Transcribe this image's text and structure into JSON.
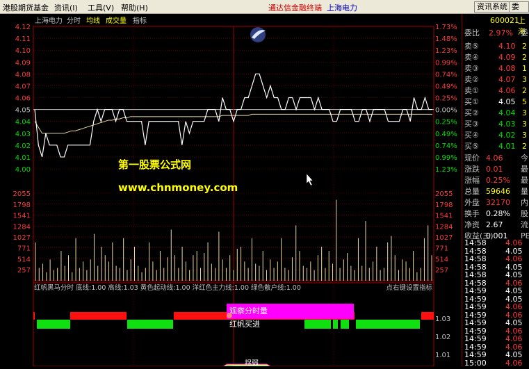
{
  "menu": {
    "title": "港股期货基金",
    "info": "资讯(I)",
    "tools": "工具(V)",
    "help": "帮助(H)",
    "brand": "通达信金融终端",
    "stock": "上海电力",
    "btn_info": "资讯系统",
    "btn_other": "委托买"
  },
  "header": {
    "name": "上海电力",
    "tabs": [
      "分时",
      "均线",
      "成交量",
      "指标"
    ]
  },
  "price_axis": {
    "left": [
      "4.12",
      "4.11",
      "4.10",
      "4.09",
      "4.08",
      "4.07",
      "4.06",
      "4.05",
      "4.04",
      "4.03",
      "4.02",
      "4.01",
      "4.00"
    ],
    "right": [
      "1.73%",
      "1.48%",
      "1.23%",
      "0.99%",
      "0.74%",
      "0.49%",
      "0.25%",
      "0.00%",
      "0.25%",
      "0.49%",
      "0.74%",
      "0.99%",
      "1.23%"
    ]
  },
  "volume_axis": [
    "2055",
    "1798",
    "1541",
    "1284",
    "1027",
    "771",
    "514",
    "257"
  ],
  "watermark": {
    "cn": "第一股票公式网",
    "url": "www.chnmoney.com"
  },
  "indicator": {
    "title_line": "红帆黑马分时  底线:1.00  高线:1.03  黄色起动线:1.00  洋红色主力线:1.00  绿色散户线:1.00",
    "right_hint": "点右键设置指标",
    "label_watch": "观察分时量",
    "label_buy": "红帆买进",
    "label_spike": "拐弱",
    "axis": [
      "1.03",
      "1.02",
      "1.01"
    ]
  },
  "time_labels": [
    "09:30",
    "11:30",
    "13:00",
    "15:00"
  ],
  "chart_data": {
    "type": "line",
    "prev_close": 4.05,
    "ylim": [
      4.0,
      4.12
    ],
    "series": [
      {
        "name": "price",
        "values": [
          4.05,
          4.02,
          4.01,
          4.03,
          4.02,
          4.02,
          4.02,
          4.01,
          4.01,
          4.02,
          4.02,
          4.02,
          4.02,
          4.02,
          4.02,
          4.02,
          4.04,
          4.05,
          4.04,
          4.05,
          4.05,
          4.05,
          4.04,
          4.05,
          4.05,
          4.04,
          4.04,
          4.04,
          4.04,
          4.04,
          4.02,
          4.04,
          4.04,
          4.04,
          4.04,
          4.04,
          4.04,
          4.04,
          4.04,
          4.04,
          4.02,
          4.04,
          4.03,
          4.04,
          4.04,
          4.04,
          4.04,
          4.05,
          4.05,
          4.05,
          4.04,
          4.06,
          4.05,
          4.05,
          4.04,
          4.05,
          4.05,
          4.06,
          4.06,
          4.07,
          4.08,
          4.08,
          4.07,
          4.06,
          4.07,
          4.06,
          4.06,
          4.05,
          4.05,
          4.06,
          4.06,
          4.05,
          4.06,
          4.06,
          4.06,
          4.06,
          4.05,
          4.06,
          4.05,
          4.05,
          4.05,
          4.04,
          4.04,
          4.05,
          4.05,
          4.05,
          4.05,
          4.04,
          4.04,
          4.05,
          4.05,
          4.04,
          4.05,
          4.05,
          4.05,
          4.05,
          4.04,
          4.04,
          4.04,
          4.04,
          4.05,
          4.05,
          4.04,
          4.06,
          4.05,
          4.05,
          4.06,
          4.05,
          4.05
        ]
      },
      {
        "name": "avg",
        "values": [
          4.04,
          4.035,
          4.03,
          4.03,
          4.03,
          4.03,
          4.03,
          4.03,
          4.03,
          4.031,
          4.032,
          4.032,
          4.033,
          4.034,
          4.035,
          4.036,
          4.037,
          4.038,
          4.039,
          4.04,
          4.041,
          4.041,
          4.042,
          4.042,
          4.043,
          4.043,
          4.044,
          4.044,
          4.044,
          4.044,
          4.044,
          4.044,
          4.044,
          4.044,
          4.044,
          4.044,
          4.044,
          4.044,
          4.044,
          4.044,
          4.044,
          4.044,
          4.044,
          4.044,
          4.044,
          4.044,
          4.044,
          4.044,
          4.044,
          4.044,
          4.044,
          4.045,
          4.045,
          4.045,
          4.045,
          4.045,
          4.045,
          4.045,
          4.045,
          4.046,
          4.046,
          4.046,
          4.046,
          4.046,
          4.046,
          4.046,
          4.046,
          4.046,
          4.046,
          4.046,
          4.046,
          4.046,
          4.046,
          4.046,
          4.046,
          4.046,
          4.046,
          4.046,
          4.046,
          4.046,
          4.046,
          4.046,
          4.046,
          4.046,
          4.046,
          4.046,
          4.046,
          4.046,
          4.046,
          4.046,
          4.046,
          4.046,
          4.046,
          4.046,
          4.046,
          4.046,
          4.046,
          4.046,
          4.046,
          4.046,
          4.046,
          4.046,
          4.046,
          4.046,
          4.046,
          4.046,
          4.046,
          4.046,
          4.046
        ]
      }
    ],
    "volume": [
      900,
      300,
      400,
      200,
      500,
      250,
      300,
      700,
      350,
      600,
      200,
      1000,
      300,
      450,
      250,
      500,
      1100,
      350,
      800,
      600,
      450,
      900,
      350,
      300,
      1000,
      250,
      500,
      800,
      350,
      200,
      300,
      900,
      450,
      250,
      700,
      300,
      550,
      1200,
      600,
      300,
      800,
      450,
      250,
      600,
      700,
      300,
      650,
      900,
      400,
      300,
      1150,
      500,
      300,
      600,
      250,
      750,
      800,
      450,
      300,
      1000,
      400,
      350,
      700,
      250,
      500,
      300,
      450,
      1000,
      300,
      250,
      550,
      1300,
      700,
      350,
      300,
      450,
      250,
      600,
      800,
      300,
      700,
      400,
      1900,
      300,
      500,
      650,
      350,
      250,
      1000,
      350,
      1400,
      300,
      450,
      800,
      250,
      300,
      900,
      1050,
      600,
      250,
      500,
      450,
      300,
      700,
      200,
      300,
      1000,
      1300,
      600
    ],
    "volume_ylim": [
      0,
      2055
    ]
  },
  "quote": {
    "code": "600021",
    "name": "上海",
    "ratio_label": "委比",
    "ratio_value": "2.97%",
    "ratio_tail": "委",
    "sells": [
      {
        "label": "卖⑤",
        "price": "4.10",
        "vol": "2"
      },
      {
        "label": "卖④",
        "price": "4.09",
        "vol": "2"
      },
      {
        "label": "卖③",
        "price": "4.08",
        "vol": "1"
      },
      {
        "label": "卖②",
        "price": "4.07",
        "vol": "3"
      },
      {
        "label": "卖①",
        "price": "4.06",
        "vol": "2"
      }
    ],
    "buys": [
      {
        "label": "买①",
        "price": "4.05",
        "vol": "5"
      },
      {
        "label": "买②",
        "price": "4.04",
        "vol": "3"
      },
      {
        "label": "买③",
        "price": "4.03",
        "vol": "3"
      },
      {
        "label": "买④",
        "price": "4.02",
        "vol": "3"
      },
      {
        "label": "买⑤",
        "price": "4.01",
        "vol": "2"
      }
    ],
    "stats": [
      {
        "label": "现价",
        "value": "4.06",
        "tail": "今",
        "color": "red"
      },
      {
        "label": "涨跌",
        "value": "0.01",
        "tail": "最",
        "color": "red"
      },
      {
        "label": "涨幅",
        "value": "0.25%",
        "tail": "最",
        "color": "red"
      },
      {
        "label": "总量",
        "value": "59646",
        "tail": "量",
        "color": "yellow"
      },
      {
        "label": "外盘",
        "value": "32170",
        "tail": "内",
        "color": "red"
      },
      {
        "label": "换手",
        "value": "0.28%",
        "tail": "股",
        "color": "white"
      },
      {
        "label": "净资",
        "value": "2.67",
        "tail": "流",
        "color": "white"
      },
      {
        "label": "收益(三)",
        "value": "0.001",
        "tail": "PE",
        "color": "white"
      }
    ],
    "ticks": [
      {
        "time": "14:58",
        "price": "4.06",
        "color": "red"
      },
      {
        "time": "14:58",
        "price": "4.05",
        "color": "white"
      },
      {
        "time": "14:58",
        "price": "4.06",
        "color": "red"
      },
      {
        "time": "14:58",
        "price": "4.05",
        "color": "white"
      },
      {
        "time": "14:58",
        "price": "4.05",
        "color": "white"
      },
      {
        "time": "14:58",
        "price": "4.06",
        "color": "red"
      },
      {
        "time": "14:59",
        "price": "4.05",
        "color": "white"
      },
      {
        "time": "14:59",
        "price": "4.05",
        "color": "white"
      },
      {
        "time": "14:59",
        "price": "4.06",
        "color": "red"
      },
      {
        "time": "14:59",
        "price": "4.06",
        "color": "red"
      },
      {
        "time": "14:59",
        "price": "4.05",
        "color": "white"
      },
      {
        "time": "14:59",
        "price": "4.06",
        "color": "red"
      },
      {
        "time": "14:59",
        "price": "4.06",
        "color": "red"
      },
      {
        "time": "14:59",
        "price": "4.06",
        "color": "red"
      },
      {
        "time": "14:59",
        "price": "4.05",
        "color": "white"
      },
      {
        "time": "15:00",
        "price": "4.06",
        "color": "red"
      }
    ]
  }
}
